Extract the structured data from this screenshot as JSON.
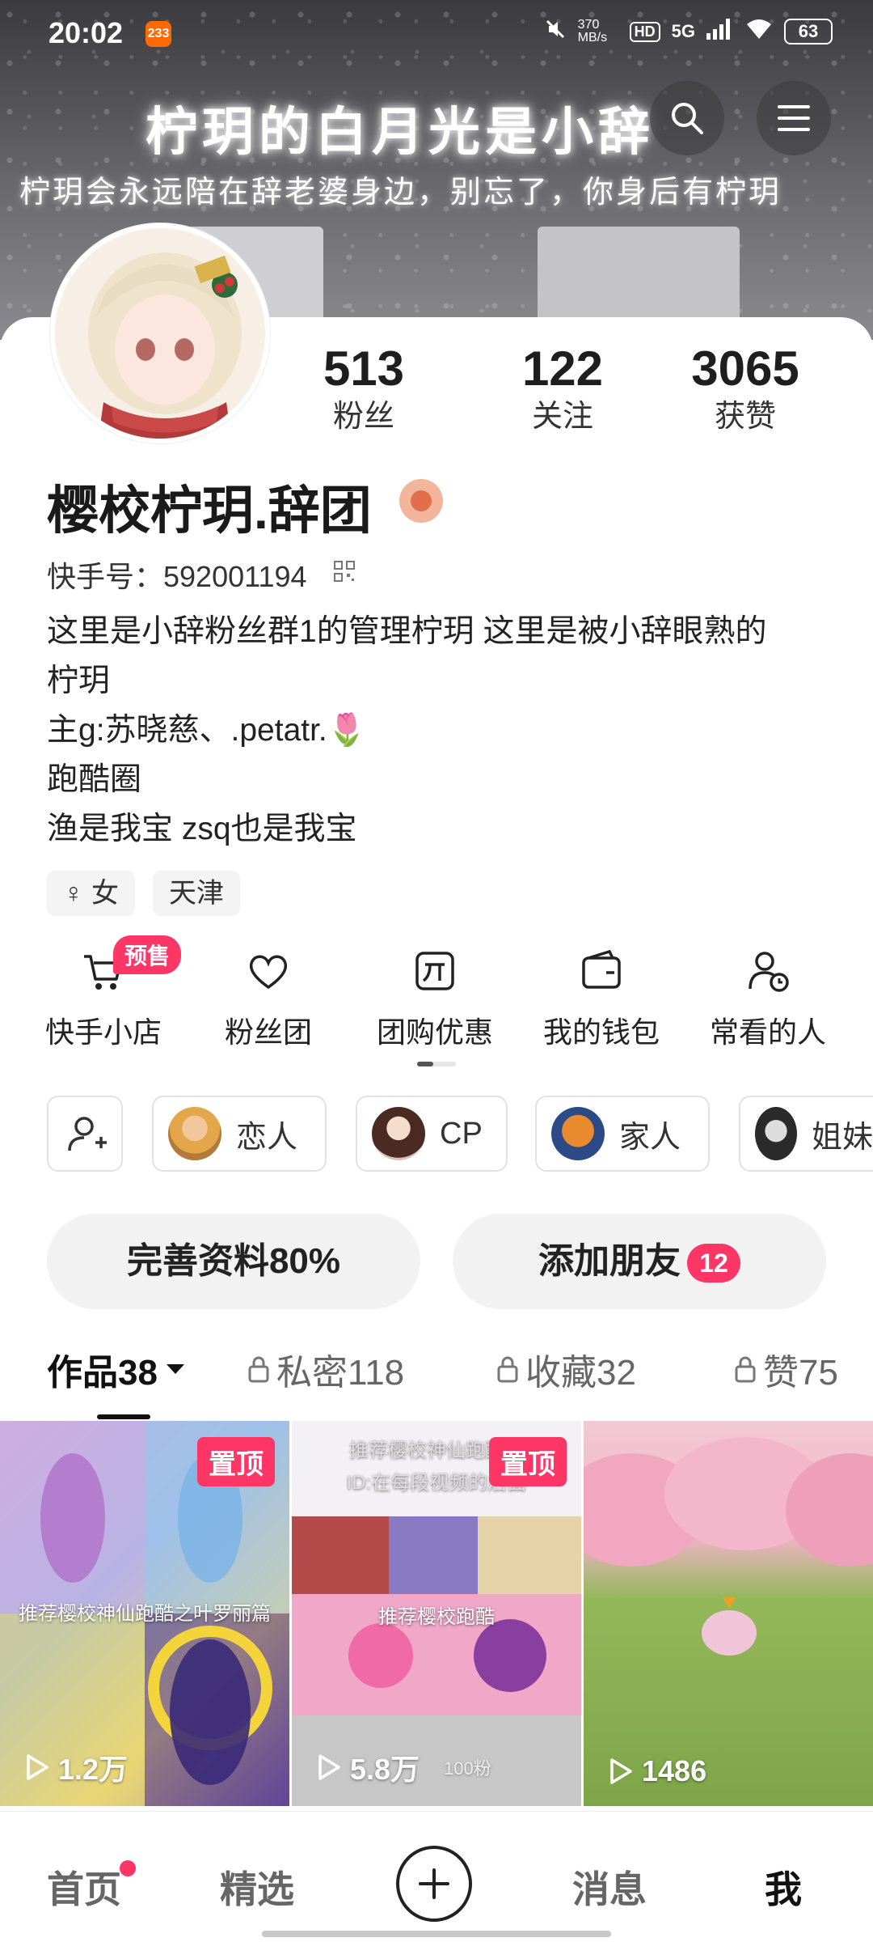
{
  "status_bar": {
    "time": "20:02",
    "app_badge": "233",
    "net_speed": "370 MB/s",
    "hd": "HD",
    "signal": "5G",
    "battery": "63"
  },
  "banner": {
    "title": "柠玥的白月光是小辞",
    "subtitle": "柠玥会永远陪在辞老婆身边，别忘了，你身后有柠玥"
  },
  "profile": {
    "stats": [
      {
        "value": "513",
        "label": "粉丝"
      },
      {
        "value": "122",
        "label": "关注"
      },
      {
        "value": "3065",
        "label": "获赞"
      }
    ],
    "name": "樱校柠玥.辞团",
    "kuaishou_id": "快手号：592001194",
    "bio_lines": [
      "这里是小辞粉丝群1的管理柠玥 这里是被小辞眼熟的",
      "柠玥",
      "主g:苏晓慈、.petatr.🌷",
      "跑酷圈",
      "渔是我宝  zsq也是我宝"
    ],
    "tags": [
      "♀ 女",
      "天津"
    ]
  },
  "shortcuts": [
    {
      "label": "快手小店",
      "icon": "cart-icon"
    },
    {
      "label": "粉丝团",
      "icon": "heart-icon"
    },
    {
      "label": "团购优惠",
      "icon": "group-buy-icon"
    },
    {
      "label": "我的钱包",
      "icon": "wallet-icon"
    },
    {
      "label": "常看的人",
      "icon": "recent-person-icon"
    }
  ],
  "presale_badge": "预售",
  "relations": [
    "恋人",
    "CP",
    "家人",
    "姐妹"
  ],
  "actions": {
    "complete_profile": "完善资料80%",
    "add_friends": "添加朋友",
    "add_friends_count": "12"
  },
  "tabs": [
    {
      "label": "作品38",
      "active": true
    },
    {
      "label": "私密118",
      "active": false
    },
    {
      "label": "收藏32",
      "active": false
    },
    {
      "label": "赞75",
      "active": false
    }
  ],
  "videos": [
    {
      "plays": "1.2万",
      "pinned": "置顶",
      "caption": "推荐樱校神仙跑酷之叶罗丽篇"
    },
    {
      "plays": "5.8万",
      "pinned": "置顶",
      "caption": "推荐樱校跑酷",
      "top_caption": "推荐樱校神仙跑酷之",
      "top_caption2": "ID:在每段视频的后面",
      "extra": "100粉"
    },
    {
      "plays": "1486"
    }
  ],
  "nav": {
    "home": "首页",
    "featured": "精选",
    "messages": "消息",
    "me": "我"
  }
}
